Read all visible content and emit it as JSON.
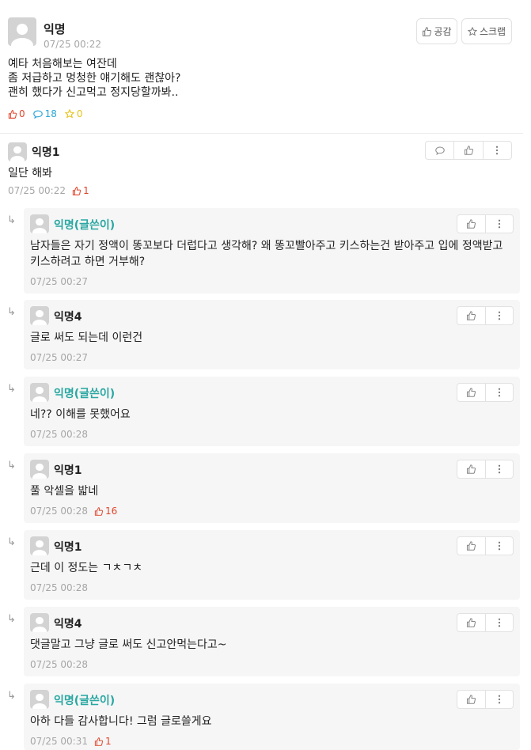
{
  "post": {
    "author": "익명",
    "time": "07/25 00:22",
    "like_button": "공감",
    "scrap_button": "스크랩",
    "body_lines": [
      "예타 처음해보는 여잔데",
      "좀 저급하고 멍청한 얘기해도 괜찮아?",
      "괜히 했다가 신고먹고 정지당할까봐.."
    ],
    "likes": "0",
    "comments": "18",
    "scraps": "0"
  },
  "comment": {
    "author": "익명1",
    "body": "일단 해봐",
    "time": "07/25 00:22",
    "votes": "1"
  },
  "replies": [
    {
      "author": "익명(글쓴이)",
      "op": true,
      "lines": [
        "남자들은 자기 정액이 똥꼬보다 더럽다고 생각해? 왜 똥꼬빨아주고 키스하는건 받아주고 입에 정액받고",
        "키스하려고 하면 거부해?"
      ],
      "time": "07/25 00:27",
      "votes": ""
    },
    {
      "author": "익명4",
      "op": false,
      "lines": [
        "글로 써도 되는데 이런건"
      ],
      "time": "07/25 00:27",
      "votes": ""
    },
    {
      "author": "익명(글쓴이)",
      "op": true,
      "lines": [
        "네?? 이해를 못했어요"
      ],
      "time": "07/25 00:28",
      "votes": ""
    },
    {
      "author": "익명1",
      "op": false,
      "lines": [
        "풀 악셀을 밟네"
      ],
      "time": "07/25 00:28",
      "votes": "16"
    },
    {
      "author": "익명1",
      "op": false,
      "lines": [
        "근데 이 정도는 ㄱㅊㄱㅊ"
      ],
      "time": "07/25 00:28",
      "votes": ""
    },
    {
      "author": "익명4",
      "op": false,
      "lines": [
        "댓글말고 그냥 글로 써도 신고안먹는다고~"
      ],
      "time": "07/25 00:28",
      "votes": ""
    },
    {
      "author": "익명(글쓴이)",
      "op": true,
      "lines": [
        "아하 다들 감사합니다! 그럼 글로쓸게요"
      ],
      "time": "07/25 00:31",
      "votes": "1"
    }
  ],
  "colors": {
    "accent_op": "#2aa7a2",
    "vote_red": "#e0452b",
    "comment_blue": "#2aa6d6",
    "scrap_yellow": "#e8c31a",
    "meta_gray": "#a6a6a6"
  },
  "icons": {
    "thumbs_up": "thumbs-up-icon",
    "speech_bubble": "speech-bubble-icon",
    "star": "star-icon",
    "more": "more-vertical-icon",
    "reply_arrow": "reply-arrow-icon"
  }
}
